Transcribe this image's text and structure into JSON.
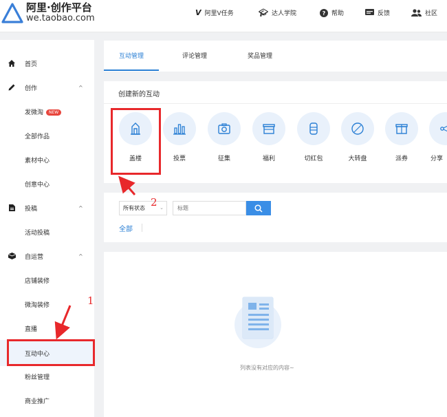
{
  "header": {
    "logo_title": "阿里·创作平台",
    "logo_domain": "we.taobao.com",
    "nav": [
      {
        "icon": "v-badge-icon",
        "label": "阿里V任务"
      },
      {
        "icon": "graduation-cap-icon",
        "label": "达人学院"
      },
      {
        "icon": "help-circle-icon",
        "label": "帮助"
      },
      {
        "icon": "feedback-icon",
        "label": "反馈"
      },
      {
        "icon": "community-icon",
        "label": "社区"
      }
    ]
  },
  "sidebar": {
    "items": [
      {
        "label": "首页",
        "icon": "home-icon"
      },
      {
        "label": "创作",
        "icon": "pen-icon",
        "chevron": "^"
      },
      {
        "label": "发微淘",
        "badge": "NEW"
      },
      {
        "label": "全部作品"
      },
      {
        "label": "素材中心"
      },
      {
        "label": "创意中心"
      },
      {
        "label": "投稿",
        "icon": "document-icon",
        "chevron": "^"
      },
      {
        "label": "活动投稿"
      },
      {
        "label": "自运营",
        "icon": "box-icon",
        "chevron": "^"
      },
      {
        "label": "店铺装修"
      },
      {
        "label": "微淘装修"
      },
      {
        "label": "直播"
      },
      {
        "label": "互动中心"
      },
      {
        "label": "粉丝管理"
      },
      {
        "label": "商业推广"
      }
    ]
  },
  "tabs": [
    {
      "label": "互动管理"
    },
    {
      "label": "评论管理"
    },
    {
      "label": "奖品管理"
    }
  ],
  "create": {
    "title": "创建新的互动",
    "items": [
      {
        "label": "盖楼",
        "icon": "building-icon"
      },
      {
        "label": "投票",
        "icon": "bar-chart-icon"
      },
      {
        "label": "征集",
        "icon": "camera-icon"
      },
      {
        "label": "福利",
        "icon": "gift-box-icon"
      },
      {
        "label": "切红包",
        "icon": "red-envelope-icon"
      },
      {
        "label": "大转盘",
        "icon": "wheel-icon"
      },
      {
        "label": "派券",
        "icon": "coupon-icon"
      },
      {
        "label": "分享",
        "icon": "share-icon"
      }
    ]
  },
  "filter": {
    "status_value": "所有状态",
    "title_placeholder": "标题",
    "all_label": "全部"
  },
  "empty": {
    "message": "列表没有对应的内容~"
  },
  "annotations": {
    "num1": "1",
    "num2": "2"
  },
  "colors": {
    "accent": "#2a7fd4",
    "annotation_red": "#e8282b",
    "icon_bg": "#e9f1fb"
  }
}
